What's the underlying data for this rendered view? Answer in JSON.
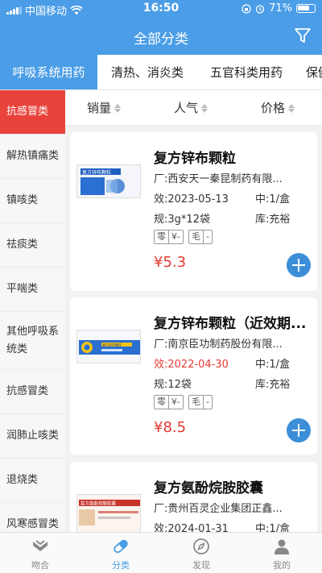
{
  "status_bar": {
    "carrier": "中国移动",
    "time": "16:50",
    "battery": "71%"
  },
  "nav": {
    "title": "全部分类"
  },
  "category_tabs": [
    "呼吸系统用药",
    "清热、消炎类",
    "五官科类用药",
    "保健"
  ],
  "category_tab_active": 0,
  "sidebar": {
    "items": [
      "抗感冒类",
      "解热镇痛类",
      "镇咳类",
      "祛痰类",
      "平喘类",
      "其他呼吸系统类",
      "抗感冒类",
      "润肺止咳类",
      "退烧类",
      "风寒感冒类"
    ],
    "active_index": 0
  },
  "sort_bar": {
    "sales": "销量",
    "popularity": "人气",
    "price": "价格"
  },
  "products": [
    {
      "name": "复方锌布颗粒",
      "manufacturer": "厂:西安天一秦昆制药有限...",
      "expiry": "效:2023-05-13",
      "middle_pack": "中:1/盒",
      "spec": "规:3g*12袋",
      "stock": "库:充裕",
      "tag1_a": "零",
      "tag1_b": "¥-",
      "tag2_a": "毛",
      "tag2_b": "-",
      "price": "¥5.3",
      "expiry_color": "normal",
      "thumb_label": "复方锌布颗粒"
    },
    {
      "name": "复方锌布颗粒（近效期...",
      "manufacturer": "厂:南京臣功制药股份有限...",
      "expiry": "效:2022-04-30",
      "middle_pack": "中:1/盒",
      "spec": "规:12袋",
      "stock": "库:充裕",
      "tag1_a": "零",
      "tag1_b": "¥-",
      "tag2_a": "毛",
      "tag2_b": "-",
      "price": "¥8.5",
      "expiry_color": "red",
      "thumb_label": "复方锌布颗粒"
    },
    {
      "name": "复方氨酚烷胺胶囊",
      "manufacturer": "厂:贵州百灵企业集团正鑫...",
      "expiry": "效:2024-01-31",
      "middle_pack": "中:1/盒",
      "thumb_label": "复方氨酚烷胺胶囊"
    }
  ],
  "tab_bar": {
    "items": [
      "吻合",
      "分类",
      "发现",
      "我的"
    ],
    "active_index": 1
  },
  "colors": {
    "primary": "#4a9de6",
    "accent_red": "#e53b33",
    "sidebar_active": "#e8423a"
  }
}
